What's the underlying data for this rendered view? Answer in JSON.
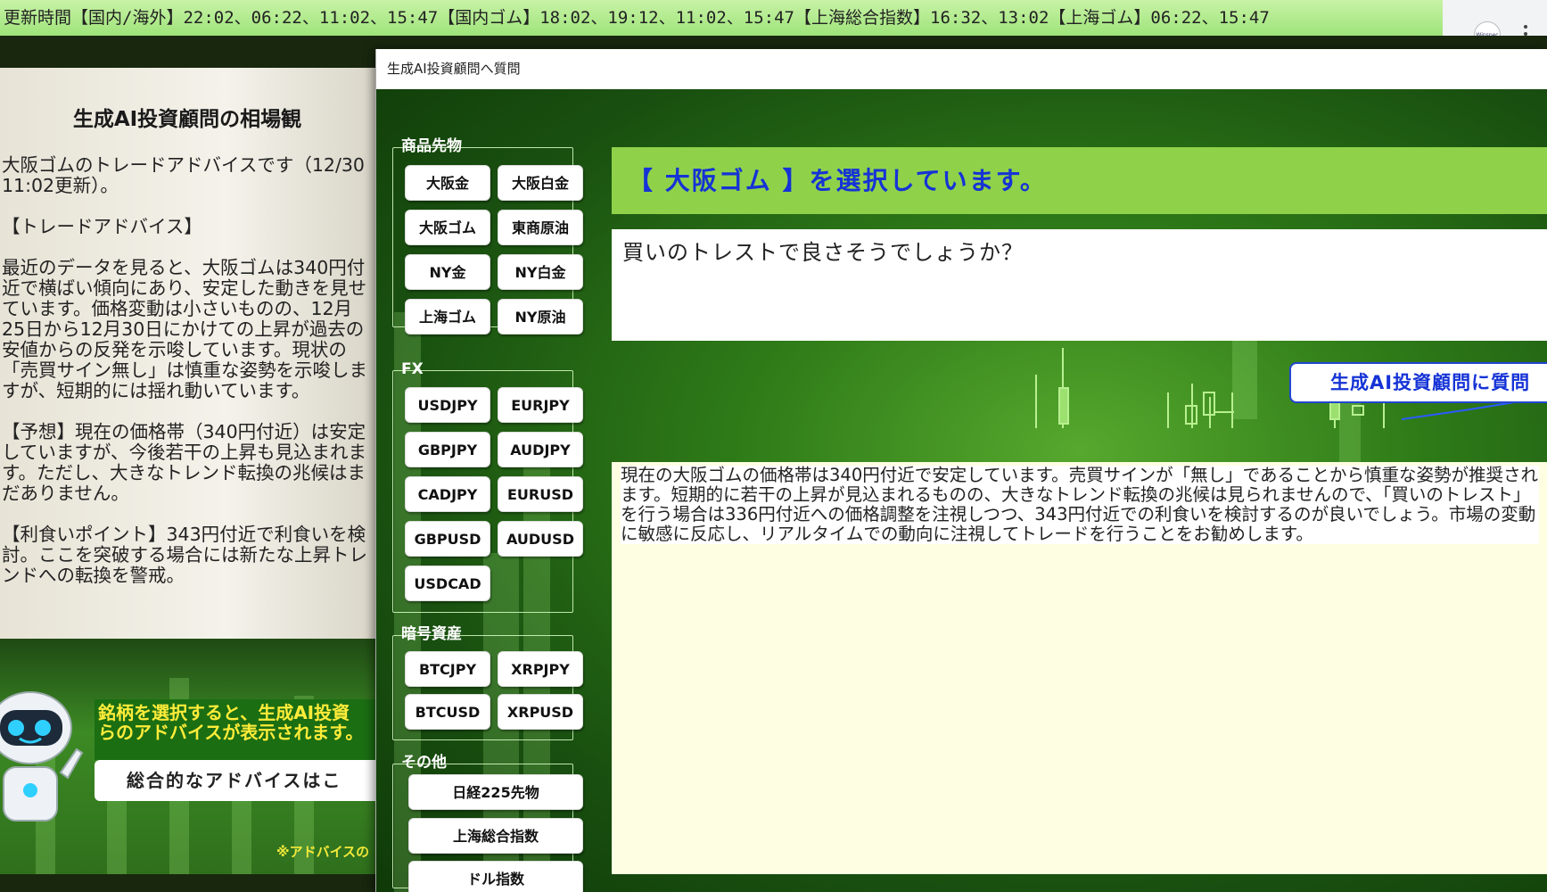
{
  "ticker": {
    "text": "更新時間【国内/海外】22:02、06:22、11:02、15:47【国内ゴム】18:02、19:12、11:02、15:47【上海総合指数】16:32、13:02【上海ゴム】06:22、15:47"
  },
  "browser": {
    "logo_text": "Winspec"
  },
  "left_panel": {
    "title": "生成AI投資顧問の相場観",
    "paragraphs": [
      "大阪ゴムのトレードアドバイスです（12/30 11:02更新）。",
      "【トレードアドバイス】",
      "最近のデータを見ると、大阪ゴムは340円付近で横ばい傾向にあり、安定した動きを見せています。価格変動は小さいものの、12月25日から12月30日にかけての上昇が過去の安値からの反発を示唆しています。現状の「売買サイン無し」は慎重な姿勢を示唆しますが、短期的には揺れ動いています。",
      "【予想】現在の価格帯（340円付近）は安定していますが、今後若干の上昇も見込まれます。ただし、大きなトレンド転換の兆候はまだありません。",
      "【利食いポイント】343円付近で利食いを検討。ここを突破する場合には新たな上昇トレンドへの転換を警戒。"
    ]
  },
  "promo": {
    "line1": "銘柄を選択すると、生成AI投資",
    "line2": "らのアドバイスが表示されます。",
    "button": "総合的なアドバイスはこ",
    "note": "※アドバイスの"
  },
  "dialog": {
    "title": "生成AI投資顧問へ質問",
    "groups": {
      "commodity": {
        "label": "商品先物",
        "buttons": [
          "大阪金",
          "大阪白金",
          "大阪ゴム",
          "東商原油",
          "NY金",
          "NY白金",
          "上海ゴム",
          "NY原油"
        ]
      },
      "fx": {
        "label": "FX",
        "buttons": [
          "USDJPY",
          "EURJPY",
          "GBPJPY",
          "AUDJPY",
          "CADJPY",
          "EURUSD",
          "GBPUSD",
          "AUDUSD",
          "USDCAD"
        ]
      },
      "crypto": {
        "label": "暗号資産",
        "buttons": [
          "BTCJPY",
          "XRPJPY",
          "BTCUSD",
          "XRPUSD"
        ]
      },
      "other": {
        "label": "その他",
        "buttons": [
          "日経225先物",
          "上海総合指数",
          "ドル指数"
        ]
      }
    },
    "selected_banner": "【 大阪ゴム 】を選択しています。",
    "question_value": "買いのトレストで良さそうでしょうか？",
    "ask_button": "生成AI投資顧問に質問",
    "answer": "現在の大阪ゴムの価格帯は340円付近で安定しています。売買サインが「無し」であることから慎重な姿勢が推奨されます。短期的に若干の上昇が見込まれるものの、大きなトレンド転換の兆候は見られませんので、「買いのトレスト」を行う場合は336円付近への価格調整を注視しつつ、343円付近での利食いを検討するのが良いでしょう。市場の変動に敏感に反応し、リアルタイムでの動向に注視してトレードを行うことをお勧めします。"
  },
  "colors": {
    "ticker_bg": "#a8e884",
    "banner_bg": "#8fd24a",
    "banner_text": "#1533d6",
    "answer_bg": "#fefee2",
    "promo_text": "#ffec3a"
  }
}
